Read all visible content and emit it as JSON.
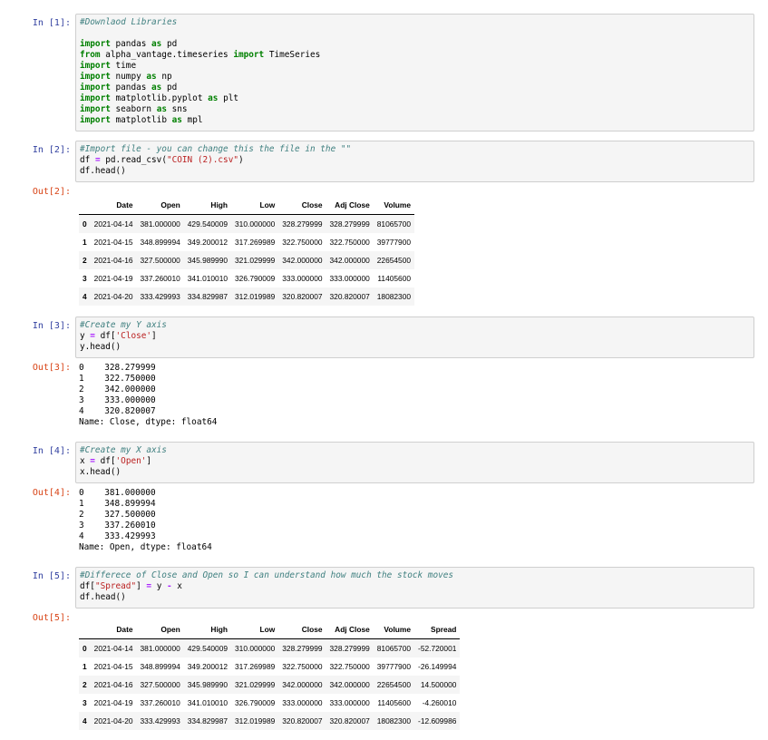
{
  "cells": [
    {
      "in_prompt": "In [1]:",
      "code": [
        [
          {
            "t": "#Downlaod Libraries",
            "c": "cm"
          }
        ],
        [],
        [
          {
            "t": "import",
            "c": "kw"
          },
          {
            "t": " pandas "
          },
          {
            "t": "as",
            "c": "kw"
          },
          {
            "t": " pd"
          }
        ],
        [
          {
            "t": "from",
            "c": "kw"
          },
          {
            "t": " alpha_vantage.timeseries "
          },
          {
            "t": "import",
            "c": "kw"
          },
          {
            "t": " TimeSeries"
          }
        ],
        [
          {
            "t": "import",
            "c": "kw"
          },
          {
            "t": " time"
          }
        ],
        [
          {
            "t": "import",
            "c": "kw"
          },
          {
            "t": " numpy "
          },
          {
            "t": "as",
            "c": "kw"
          },
          {
            "t": " np"
          }
        ],
        [
          {
            "t": "import",
            "c": "kw"
          },
          {
            "t": " pandas "
          },
          {
            "t": "as",
            "c": "kw"
          },
          {
            "t": " pd"
          }
        ],
        [
          {
            "t": "import",
            "c": "kw"
          },
          {
            "t": " matplotlib.pyplot "
          },
          {
            "t": "as",
            "c": "kw"
          },
          {
            "t": " plt"
          }
        ],
        [
          {
            "t": "import",
            "c": "kw"
          },
          {
            "t": " seaborn "
          },
          {
            "t": "as",
            "c": "kw"
          },
          {
            "t": " sns"
          }
        ],
        [
          {
            "t": "import",
            "c": "kw"
          },
          {
            "t": " matplotlib "
          },
          {
            "t": "as",
            "c": "kw"
          },
          {
            "t": " mpl"
          }
        ]
      ]
    },
    {
      "in_prompt": "In [2]:",
      "code": [
        [
          {
            "t": "#Import file - you can change this the file in the \"\"",
            "c": "cm"
          }
        ],
        [
          {
            "t": "df "
          },
          {
            "t": "=",
            "c": "op"
          },
          {
            "t": " pd.read_csv("
          },
          {
            "t": "\"COIN (2).csv\"",
            "c": "st"
          },
          {
            "t": ")"
          }
        ],
        [
          {
            "t": "df.head()"
          }
        ]
      ],
      "out_prompt": "Out[2]:",
      "table": {
        "columns": [
          "",
          "Date",
          "Open",
          "High",
          "Low",
          "Close",
          "Adj Close",
          "Volume"
        ],
        "rows": [
          [
            "0",
            "2021-04-14",
            "381.000000",
            "429.540009",
            "310.000000",
            "328.279999",
            "328.279999",
            "81065700"
          ],
          [
            "1",
            "2021-04-15",
            "348.899994",
            "349.200012",
            "317.269989",
            "322.750000",
            "322.750000",
            "39777900"
          ],
          [
            "2",
            "2021-04-16",
            "327.500000",
            "345.989990",
            "321.029999",
            "342.000000",
            "342.000000",
            "22654500"
          ],
          [
            "3",
            "2021-04-19",
            "337.260010",
            "341.010010",
            "326.790009",
            "333.000000",
            "333.000000",
            "11405600"
          ],
          [
            "4",
            "2021-04-20",
            "333.429993",
            "334.829987",
            "312.019989",
            "320.820007",
            "320.820007",
            "18082300"
          ]
        ]
      }
    },
    {
      "in_prompt": "In [3]:",
      "code": [
        [
          {
            "t": "#Create my Y axis",
            "c": "cm"
          }
        ],
        [
          {
            "t": "y "
          },
          {
            "t": "=",
            "c": "op"
          },
          {
            "t": " df["
          },
          {
            "t": "'Close'",
            "c": "st"
          },
          {
            "t": "]"
          }
        ],
        [
          {
            "t": "y.head()"
          }
        ]
      ],
      "out_prompt": "Out[3]:",
      "output": [
        "0    328.279999",
        "1    322.750000",
        "2    342.000000",
        "3    333.000000",
        "4    320.820007",
        "Name: Close, dtype: float64"
      ]
    },
    {
      "in_prompt": "In [4]:",
      "code": [
        [
          {
            "t": "#Create my X axis",
            "c": "cm"
          }
        ],
        [
          {
            "t": "x "
          },
          {
            "t": "=",
            "c": "op"
          },
          {
            "t": " df["
          },
          {
            "t": "'Open'",
            "c": "st"
          },
          {
            "t": "]"
          }
        ],
        [
          {
            "t": "x.head()"
          }
        ]
      ],
      "out_prompt": "Out[4]:",
      "output": [
        "0    381.000000",
        "1    348.899994",
        "2    327.500000",
        "3    337.260010",
        "4    333.429993",
        "Name: Open, dtype: float64"
      ]
    },
    {
      "in_prompt": "In [5]:",
      "code": [
        [
          {
            "t": "#Differece of Close and Open so I can understand how much the stock moves",
            "c": "cm"
          }
        ],
        [
          {
            "t": "df["
          },
          {
            "t": "\"Spread\"",
            "c": "st"
          },
          {
            "t": "] "
          },
          {
            "t": "=",
            "c": "op"
          },
          {
            "t": " y "
          },
          {
            "t": "-",
            "c": "op"
          },
          {
            "t": " x"
          }
        ],
        [
          {
            "t": "df.head()"
          }
        ]
      ],
      "out_prompt": "Out[5]:",
      "table": {
        "columns": [
          "",
          "Date",
          "Open",
          "High",
          "Low",
          "Close",
          "Adj Close",
          "Volume",
          "Spread"
        ],
        "rows": [
          [
            "0",
            "2021-04-14",
            "381.000000",
            "429.540009",
            "310.000000",
            "328.279999",
            "328.279999",
            "81065700",
            "-52.720001"
          ],
          [
            "1",
            "2021-04-15",
            "348.899994",
            "349.200012",
            "317.269989",
            "322.750000",
            "322.750000",
            "39777900",
            "-26.149994"
          ],
          [
            "2",
            "2021-04-16",
            "327.500000",
            "345.989990",
            "321.029999",
            "342.000000",
            "342.000000",
            "22654500",
            "14.500000"
          ],
          [
            "3",
            "2021-04-19",
            "337.260010",
            "341.010010",
            "326.790009",
            "333.000000",
            "333.000000",
            "11405600",
            "-4.260010"
          ],
          [
            "4",
            "2021-04-20",
            "333.429993",
            "334.829987",
            "312.019989",
            "320.820007",
            "320.820007",
            "18082300",
            "-12.609986"
          ]
        ]
      }
    }
  ]
}
